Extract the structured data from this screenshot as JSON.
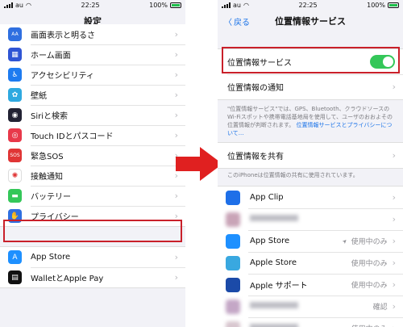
{
  "left": {
    "status": {
      "carrier": "au",
      "time": "22:25",
      "battery": "100%"
    },
    "title": "設定",
    "items": [
      {
        "label": "画面表示と明るさ",
        "icon": "aa-icon",
        "color": "#2f6fe0",
        "glyph": "AA"
      },
      {
        "label": "ホーム画面",
        "icon": "home-grid-icon",
        "color": "#2f55d4",
        "glyph": "▦"
      },
      {
        "label": "アクセシビリティ",
        "icon": "accessibility-icon",
        "color": "#1e7bf0",
        "glyph": "♿"
      },
      {
        "label": "壁紙",
        "icon": "wallpaper-icon",
        "color": "#2fa9e0",
        "glyph": "✿"
      },
      {
        "label": "Siriと検索",
        "icon": "siri-icon",
        "color": "#222233",
        "glyph": "◉"
      },
      {
        "label": "Touch IDとパスコード",
        "icon": "fingerprint-icon",
        "color": "#e8394a",
        "glyph": "◎"
      },
      {
        "label": "緊急SOS",
        "icon": "sos-icon",
        "color": "#e03535",
        "glyph": "SOS"
      },
      {
        "label": "接触通知",
        "icon": "exposure-notification-icon",
        "color": "#ffffff",
        "glyph": "✺"
      },
      {
        "label": "バッテリー",
        "icon": "battery-icon",
        "color": "#34c759",
        "glyph": "▬"
      },
      {
        "label": "プライバシー",
        "icon": "hand-icon",
        "color": "#2f6fe0",
        "glyph": "✋"
      }
    ],
    "items2": [
      {
        "label": "App Store",
        "icon": "app-store-icon",
        "color": "#1e90ff",
        "glyph": "A"
      },
      {
        "label": "WalletとApple Pay",
        "icon": "wallet-icon",
        "color": "#111111",
        "glyph": "▤"
      }
    ]
  },
  "right": {
    "status": {
      "carrier": "au",
      "time": "22:25",
      "battery": "100%"
    },
    "back": "戻る",
    "title": "位置情報サービス",
    "location_services": "位置情報サービス",
    "location_alerts": "位置情報の通知",
    "description": "\"位置情報サービス\"では、GPS、Bluetooth、クラウドソースのWi-Fiスポットや携帯電話基地局を使用して、ユーザのおおよその位置情報が判断されます。",
    "description_link": "位置情報サービスとプライバシーについて...",
    "share_location": "位置情報を共有",
    "share_note": "このiPhoneは位置情報の共有に使用されています。",
    "apps": [
      {
        "label": "App Clip",
        "icon": "app-clip-icon",
        "color": "#1e6fe8",
        "value": "",
        "blurred": false
      },
      {
        "label": "",
        "icon": "blurred-app-icon",
        "color": "#c9a4b7",
        "value": "",
        "blurred": true
      },
      {
        "label": "App Store",
        "icon": "app-store-icon",
        "color": "#1e90ff",
        "value": "使用中のみ",
        "blurred": false,
        "arrow": true
      },
      {
        "label": "Apple Store",
        "icon": "apple-store-icon",
        "color": "#39a8e0",
        "value": "使用中のみ",
        "blurred": false
      },
      {
        "label": "Apple サポート",
        "icon": "apple-support-icon",
        "color": "#1b4aa8",
        "value": "使用中のみ",
        "blurred": false
      },
      {
        "label": "",
        "icon": "blurred-app-icon",
        "color": "#c4a7c6",
        "value": "確認",
        "blurred": true
      },
      {
        "label": "",
        "icon": "blurred-app-icon",
        "color": "#d8c6cf",
        "value": "使用中のみ",
        "blurred": true
      }
    ]
  },
  "colors": {
    "highlight": "#c9202a",
    "arrow": "#e02020",
    "toggle_on": "#34c759",
    "link": "#1a73e8"
  }
}
